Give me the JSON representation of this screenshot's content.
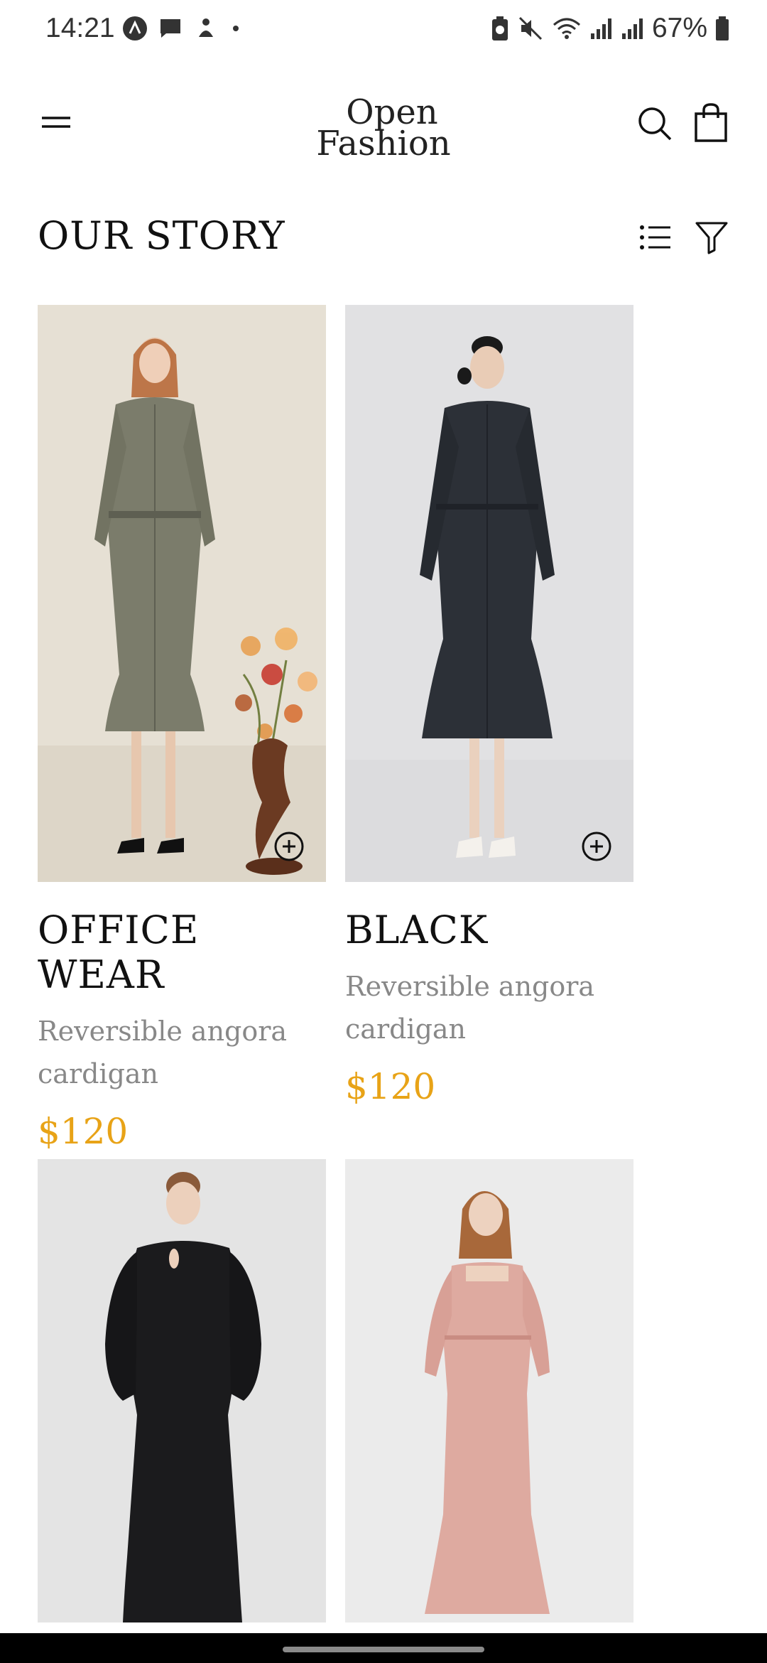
{
  "status_bar": {
    "time": "14:21",
    "battery": "67%",
    "icons_left": [
      "a-icon",
      "message-icon",
      "bot-icon",
      "dot-icon"
    ],
    "icons_right": [
      "battery-saver-icon",
      "mute-icon",
      "wifi-icon",
      "signal-icon",
      "signal-icon",
      "battery-icon"
    ]
  },
  "header": {
    "logo_line1": "Open",
    "logo_line2": "Fashion",
    "menu_icon": "menu-icon",
    "search_icon": "search-icon",
    "bag_icon": "shopping-bag-icon"
  },
  "page": {
    "title": "OUR STORY",
    "view_icon": "list-view-icon",
    "filter_icon": "filter-icon"
  },
  "products": [
    {
      "name": "OFFICE WEAR",
      "desc_line1": "Reversible angora",
      "desc_line2": "cardigan",
      "price": "$120"
    },
    {
      "name": "BLACK",
      "desc_line1": "Reversible angora",
      "desc_line2": "cardigan",
      "price": "$120"
    },
    {
      "name": "",
      "desc_line1": "",
      "desc_line2": "",
      "price": ""
    },
    {
      "name": "",
      "desc_line1": "",
      "desc_line2": "",
      "price": ""
    }
  ],
  "colors": {
    "accent_price": "#e8a317",
    "title": "#111111",
    "description": "#888888"
  }
}
